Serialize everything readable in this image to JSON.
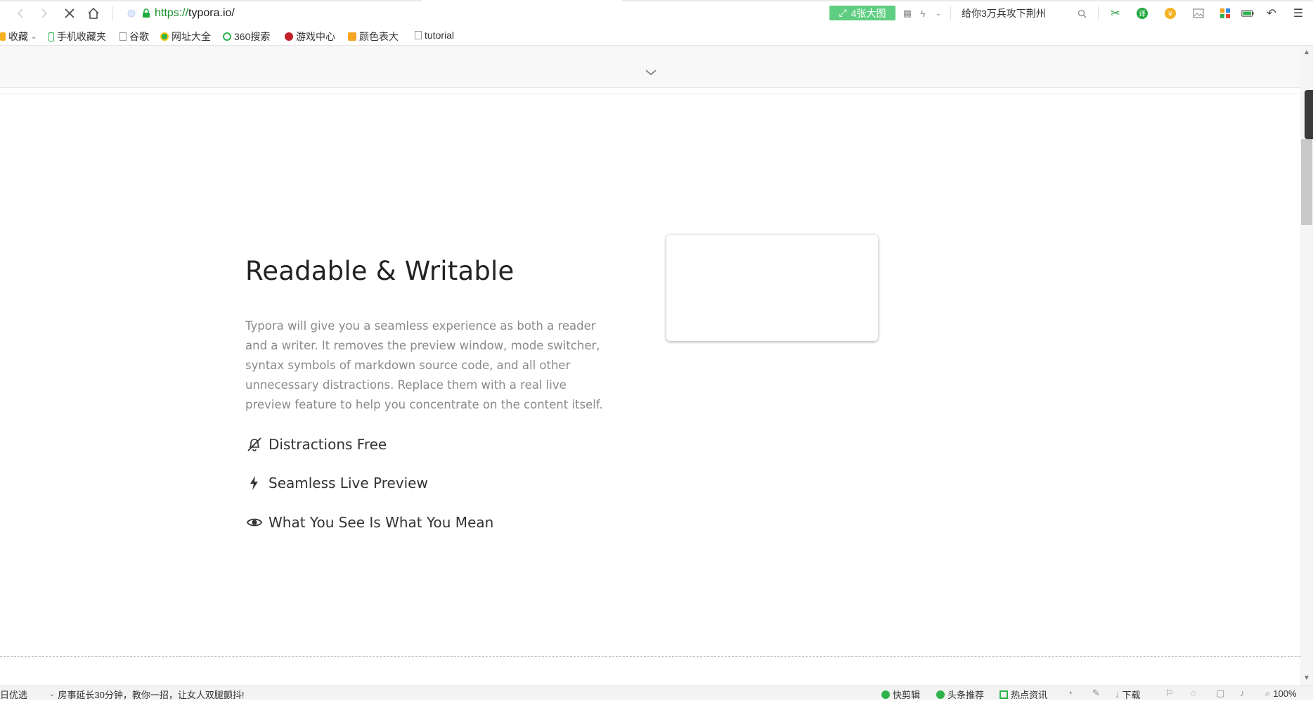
{
  "browser": {
    "url_scheme": "https://",
    "url_host": "typora.io/",
    "big_image_badge": "4张大图",
    "search_text": "给你3万兵攻下荆州"
  },
  "bookmarks": [
    {
      "label": "收藏"
    },
    {
      "label": "手机收藏夹"
    },
    {
      "label": "谷歌"
    },
    {
      "label": "网址大全"
    },
    {
      "label": "360搜索"
    },
    {
      "label": "游戏中心"
    },
    {
      "label": "颜色表大"
    },
    {
      "label": "tutorial"
    }
  ],
  "main": {
    "heading": "Readable & Writable",
    "paragraph": "Typora will give you a seamless experience as both a reader and a writer. It removes the preview window, mode switcher, syntax symbols of markdown source code, and all other unnecessary distractions. Replace them with a real live preview feature to help you concentrate on the content itself.",
    "features": [
      {
        "label": "Distractions Free",
        "icon": "bell-slash-icon"
      },
      {
        "label": "Seamless Live Preview",
        "icon": "bolt-icon"
      },
      {
        "label": "What You See Is What You Mean",
        "icon": "eye-icon"
      }
    ]
  },
  "statusbar": {
    "left_label": "日优选",
    "news_ticker": "房事延长30分钟，教你一招，让女人双腿颤抖!",
    "quick_clip": "快剪辑",
    "headline_recommend": "头条推荐",
    "hot_news": "热点资讯",
    "download": "下载",
    "zoom": "100%"
  },
  "colors": {
    "badge_green": "#5fce82",
    "secure_green": "#1a8f2c",
    "body_text": "#8a8a8a",
    "heading_text": "#222222"
  }
}
